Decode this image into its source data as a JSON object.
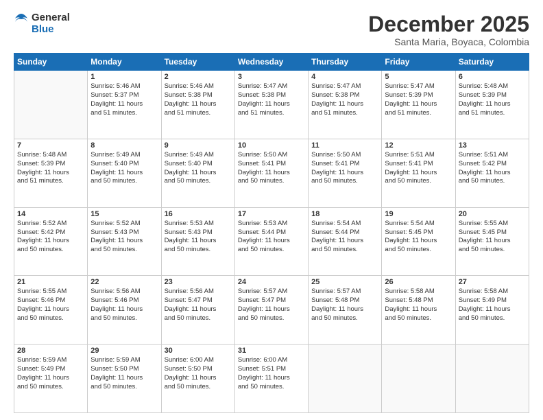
{
  "header": {
    "logo_line1": "General",
    "logo_line2": "Blue",
    "title": "December 2025",
    "subtitle": "Santa Maria, Boyaca, Colombia"
  },
  "weekdays": [
    "Sunday",
    "Monday",
    "Tuesday",
    "Wednesday",
    "Thursday",
    "Friday",
    "Saturday"
  ],
  "weeks": [
    [
      {
        "day": "",
        "info": ""
      },
      {
        "day": "1",
        "info": "Sunrise: 5:46 AM\nSunset: 5:37 PM\nDaylight: 11 hours\nand 51 minutes."
      },
      {
        "day": "2",
        "info": "Sunrise: 5:46 AM\nSunset: 5:38 PM\nDaylight: 11 hours\nand 51 minutes."
      },
      {
        "day": "3",
        "info": "Sunrise: 5:47 AM\nSunset: 5:38 PM\nDaylight: 11 hours\nand 51 minutes."
      },
      {
        "day": "4",
        "info": "Sunrise: 5:47 AM\nSunset: 5:38 PM\nDaylight: 11 hours\nand 51 minutes."
      },
      {
        "day": "5",
        "info": "Sunrise: 5:47 AM\nSunset: 5:39 PM\nDaylight: 11 hours\nand 51 minutes."
      },
      {
        "day": "6",
        "info": "Sunrise: 5:48 AM\nSunset: 5:39 PM\nDaylight: 11 hours\nand 51 minutes."
      }
    ],
    [
      {
        "day": "7",
        "info": "Sunrise: 5:48 AM\nSunset: 5:39 PM\nDaylight: 11 hours\nand 51 minutes."
      },
      {
        "day": "8",
        "info": "Sunrise: 5:49 AM\nSunset: 5:40 PM\nDaylight: 11 hours\nand 50 minutes."
      },
      {
        "day": "9",
        "info": "Sunrise: 5:49 AM\nSunset: 5:40 PM\nDaylight: 11 hours\nand 50 minutes."
      },
      {
        "day": "10",
        "info": "Sunrise: 5:50 AM\nSunset: 5:41 PM\nDaylight: 11 hours\nand 50 minutes."
      },
      {
        "day": "11",
        "info": "Sunrise: 5:50 AM\nSunset: 5:41 PM\nDaylight: 11 hours\nand 50 minutes."
      },
      {
        "day": "12",
        "info": "Sunrise: 5:51 AM\nSunset: 5:41 PM\nDaylight: 11 hours\nand 50 minutes."
      },
      {
        "day": "13",
        "info": "Sunrise: 5:51 AM\nSunset: 5:42 PM\nDaylight: 11 hours\nand 50 minutes."
      }
    ],
    [
      {
        "day": "14",
        "info": "Sunrise: 5:52 AM\nSunset: 5:42 PM\nDaylight: 11 hours\nand 50 minutes."
      },
      {
        "day": "15",
        "info": "Sunrise: 5:52 AM\nSunset: 5:43 PM\nDaylight: 11 hours\nand 50 minutes."
      },
      {
        "day": "16",
        "info": "Sunrise: 5:53 AM\nSunset: 5:43 PM\nDaylight: 11 hours\nand 50 minutes."
      },
      {
        "day": "17",
        "info": "Sunrise: 5:53 AM\nSunset: 5:44 PM\nDaylight: 11 hours\nand 50 minutes."
      },
      {
        "day": "18",
        "info": "Sunrise: 5:54 AM\nSunset: 5:44 PM\nDaylight: 11 hours\nand 50 minutes."
      },
      {
        "day": "19",
        "info": "Sunrise: 5:54 AM\nSunset: 5:45 PM\nDaylight: 11 hours\nand 50 minutes."
      },
      {
        "day": "20",
        "info": "Sunrise: 5:55 AM\nSunset: 5:45 PM\nDaylight: 11 hours\nand 50 minutes."
      }
    ],
    [
      {
        "day": "21",
        "info": "Sunrise: 5:55 AM\nSunset: 5:46 PM\nDaylight: 11 hours\nand 50 minutes."
      },
      {
        "day": "22",
        "info": "Sunrise: 5:56 AM\nSunset: 5:46 PM\nDaylight: 11 hours\nand 50 minutes."
      },
      {
        "day": "23",
        "info": "Sunrise: 5:56 AM\nSunset: 5:47 PM\nDaylight: 11 hours\nand 50 minutes."
      },
      {
        "day": "24",
        "info": "Sunrise: 5:57 AM\nSunset: 5:47 PM\nDaylight: 11 hours\nand 50 minutes."
      },
      {
        "day": "25",
        "info": "Sunrise: 5:57 AM\nSunset: 5:48 PM\nDaylight: 11 hours\nand 50 minutes."
      },
      {
        "day": "26",
        "info": "Sunrise: 5:58 AM\nSunset: 5:48 PM\nDaylight: 11 hours\nand 50 minutes."
      },
      {
        "day": "27",
        "info": "Sunrise: 5:58 AM\nSunset: 5:49 PM\nDaylight: 11 hours\nand 50 minutes."
      }
    ],
    [
      {
        "day": "28",
        "info": "Sunrise: 5:59 AM\nSunset: 5:49 PM\nDaylight: 11 hours\nand 50 minutes."
      },
      {
        "day": "29",
        "info": "Sunrise: 5:59 AM\nSunset: 5:50 PM\nDaylight: 11 hours\nand 50 minutes."
      },
      {
        "day": "30",
        "info": "Sunrise: 6:00 AM\nSunset: 5:50 PM\nDaylight: 11 hours\nand 50 minutes."
      },
      {
        "day": "31",
        "info": "Sunrise: 6:00 AM\nSunset: 5:51 PM\nDaylight: 11 hours\nand 50 minutes."
      },
      {
        "day": "",
        "info": ""
      },
      {
        "day": "",
        "info": ""
      },
      {
        "day": "",
        "info": ""
      }
    ]
  ]
}
